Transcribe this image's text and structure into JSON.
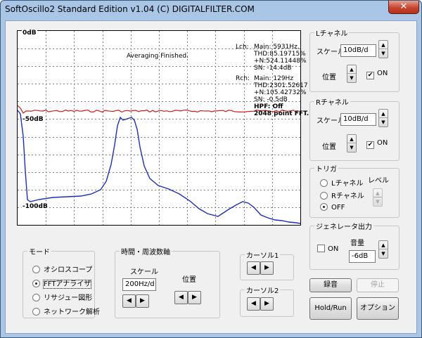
{
  "window": {
    "title": "SoftOscillo2 Standard Edition v1.04 (C) DIGITALFILTER.COM",
    "close": "✕"
  },
  "scope": {
    "labels": {
      "top": "0dB",
      "mid": "-50dB",
      "bottom": "-100dB"
    },
    "status": "Averaging Finished.",
    "lch": {
      "label": "Lch:",
      "lines": [
        "Main: 5931Hz,",
        "THD:85.19715%",
        "+N:524.11448%",
        "SN: -14.4dB"
      ]
    },
    "rch": {
      "label": "Rch:",
      "lines": [
        "Main:  129Hz",
        "THD:2301.52617",
        "+N:105.42732%",
        "SN:  -0.5dB"
      ]
    },
    "hpf": "HPF: Off",
    "fft": "2048 point FFT.",
    "colors": {
      "red_trace": "#d01818",
      "blue_trace": "#1c2fb8"
    }
  },
  "lch": {
    "title": "Lチャネル",
    "scale_label": "スケール",
    "scale_value": "10dB/d",
    "position_label": "位置",
    "on_label": "ON",
    "on": true
  },
  "rch": {
    "title": "Rチャネル",
    "scale_label": "スケール",
    "scale_value": "10dB/d",
    "position_label": "位置",
    "on_label": "ON",
    "on": true
  },
  "trigger": {
    "title": "トリガ",
    "level_label": "レベル",
    "options": [
      "Lチャネル",
      "Rチャネル",
      "OFF"
    ],
    "selected": "OFF"
  },
  "generator": {
    "title": "ジェネレータ出力",
    "on_label": "ON",
    "volume_label": "音量",
    "volume_value": "-6dB"
  },
  "mode": {
    "title": "モード",
    "options": [
      "オシロスコープ",
      "FFTアナライザ",
      "リサジュー図形",
      "ネットワーク解析"
    ],
    "selected": "FFTアナライザ"
  },
  "time": {
    "title": "時間・周波数軸",
    "scale_label": "スケール",
    "scale_value": "200Hz/d",
    "position_label": "位置"
  },
  "cursor1": {
    "title": "カーソル1"
  },
  "cursor2": {
    "title": "カーソル2"
  },
  "arrows": {
    "left": "◀",
    "right": "▶",
    "up": "▲",
    "down": "▼"
  },
  "check_mark": "✔",
  "buttons": {
    "record": "録音",
    "stop": "停止",
    "hold": "Hold/Run",
    "option": "オプション"
  }
}
